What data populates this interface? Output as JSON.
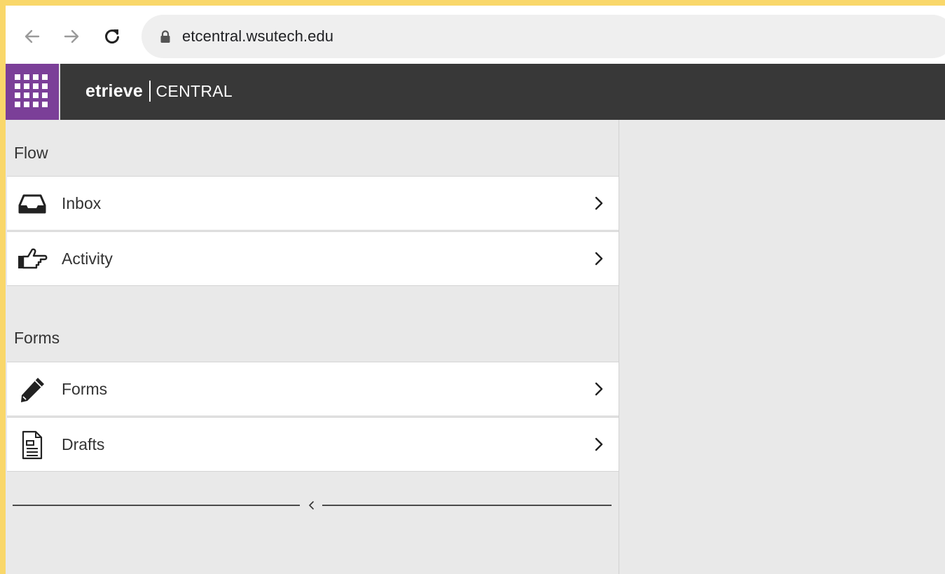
{
  "browser": {
    "url": "etcentral.wsutech.edu",
    "icons": {
      "back": "arrow-left-icon",
      "forward": "arrow-right-icon",
      "reload": "reload-icon",
      "lock": "lock-icon"
    }
  },
  "header": {
    "logo_text": "etrieve",
    "product": "CENTRAL",
    "colors": {
      "header_bg": "#383838",
      "launcher_bg": "#7b3f98"
    }
  },
  "sidebar": {
    "sections": [
      {
        "title": "Flow",
        "items": [
          {
            "label": "Inbox",
            "icon": "inbox-tray-icon"
          },
          {
            "label": "Activity",
            "icon": "pointing-hand-icon"
          }
        ]
      },
      {
        "title": "Forms",
        "items": [
          {
            "label": "Forms",
            "icon": "pencil-icon"
          },
          {
            "label": "Drafts",
            "icon": "document-icon"
          }
        ]
      }
    ],
    "collapse_icon": "chevron-left-icon"
  },
  "frame_color": "#f9d76a"
}
